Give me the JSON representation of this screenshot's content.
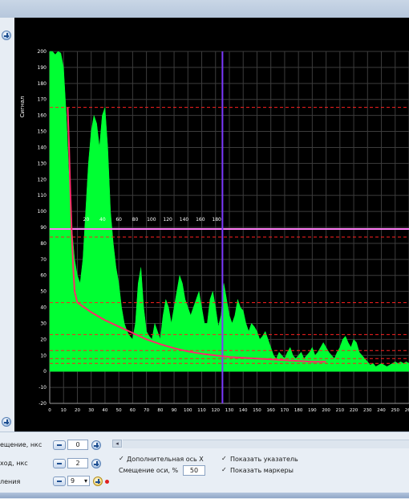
{
  "chart_data": {
    "type": "area",
    "ylabel": "Сигнал",
    "y_ticks": [
      "200",
      "190",
      "180",
      "170",
      "160",
      "150",
      "140",
      "130",
      "120",
      "110",
      "100",
      "90",
      "80",
      "70",
      "60",
      "50",
      "40",
      "30",
      "20",
      "10",
      "0",
      "-10",
      "-20"
    ],
    "x_ticks": [
      "0",
      "10",
      "20",
      "30",
      "40",
      "50",
      "60",
      "70",
      "80",
      "90",
      "100",
      "110",
      "120",
      "130",
      "140",
      "150",
      "160",
      "170",
      "180",
      "190",
      "200",
      "210",
      "220",
      "230",
      "240",
      "250",
      "260"
    ],
    "secondary_x_ticks": [
      "20",
      "40",
      "60",
      "80",
      "100",
      "120",
      "140",
      "160",
      "180"
    ],
    "xlim": [
      0,
      260
    ],
    "ylim": [
      -20,
      200
    ],
    "grid": true,
    "series": [
      {
        "color": "#00ff33",
        "x": [
          0,
          2,
          4,
          6,
          8,
          10,
          12,
          14,
          16,
          18,
          20,
          22,
          24,
          26,
          28,
          30,
          32,
          34,
          36,
          38,
          40,
          42,
          44,
          46,
          48,
          50,
          52,
          54,
          56,
          58,
          60,
          62,
          64,
          66,
          68,
          70,
          72,
          74,
          76,
          78,
          80,
          82,
          84,
          86,
          88,
          90,
          92,
          94,
          96,
          98,
          100,
          102,
          104,
          106,
          108,
          110,
          112,
          114,
          116,
          118,
          120,
          122,
          124,
          126,
          128,
          130,
          132,
          134,
          136,
          138,
          140,
          142,
          144,
          146,
          148,
          150,
          152,
          154,
          156,
          158,
          160,
          162,
          164,
          166,
          168,
          170,
          172,
          174,
          176,
          178,
          180,
          182,
          184,
          186,
          188,
          190,
          192,
          194,
          196,
          198,
          200,
          202,
          204,
          206,
          208,
          210,
          212,
          214,
          216,
          218,
          220,
          222,
          224,
          226,
          228,
          230,
          232,
          234,
          236,
          238,
          240,
          242,
          244,
          246,
          248,
          250,
          252,
          254,
          256,
          258,
          260
        ],
        "values": [
          200,
          200,
          198,
          200,
          199,
          190,
          160,
          120,
          90,
          70,
          60,
          55,
          70,
          100,
          130,
          150,
          160,
          155,
          140,
          160,
          165,
          140,
          100,
          80,
          65,
          55,
          40,
          30,
          25,
          22,
          20,
          30,
          55,
          65,
          40,
          25,
          22,
          20,
          30,
          25,
          20,
          35,
          45,
          40,
          30,
          40,
          50,
          60,
          55,
          45,
          40,
          35,
          40,
          45,
          50,
          40,
          30,
          30,
          45,
          50,
          40,
          28,
          35,
          55,
          45,
          35,
          30,
          35,
          45,
          40,
          38,
          30,
          25,
          30,
          28,
          25,
          20,
          22,
          25,
          20,
          15,
          10,
          8,
          12,
          10,
          8,
          12,
          15,
          10,
          8,
          10,
          12,
          8,
          10,
          12,
          15,
          10,
          12,
          15,
          18,
          15,
          12,
          10,
          8,
          12,
          15,
          20,
          22,
          18,
          15,
          20,
          18,
          12,
          10,
          8,
          6,
          4,
          5,
          3,
          4,
          5,
          4,
          3,
          4,
          5,
          6,
          5,
          6,
          5,
          6,
          5
        ]
      },
      {
        "color": "#ff2a6a",
        "x": [
          13,
          14,
          15,
          16,
          17,
          18,
          20,
          25,
          30,
          40,
          50,
          60,
          70,
          80,
          90,
          100,
          110,
          120,
          130,
          140,
          150,
          160,
          170,
          180,
          190,
          200
        ],
        "values": [
          165,
          140,
          110,
          85,
          65,
          50,
          43,
          40,
          37,
          32,
          28,
          24,
          20,
          17,
          14.5,
          12.5,
          11,
          10,
          9,
          8.5,
          8,
          7.5,
          7,
          6.5,
          6,
          6
        ]
      }
    ],
    "reference_lines": {
      "horizontal_red_dashed": [
        165,
        84,
        43,
        23,
        13,
        8,
        5
      ],
      "horizontal_pink_marker": 89,
      "vertical_purple_marker": 125
    }
  },
  "controls": {
    "offset_label": "ещение, нкс",
    "offset_value": "0",
    "step_label": "ход, нкс",
    "step_value": "2",
    "mode_label": "ления",
    "mode_value": "9",
    "extra_axis_label": "Дополнительная ось X",
    "axis_offset_label": "Смещение оси, %",
    "axis_offset_value": "50",
    "show_pointer_label": "Показать указатель",
    "show_markers_label": "Показать маркеры",
    "check_mark": "✓",
    "dropdown_arrow": "▾",
    "scroll_arrow": "◂"
  }
}
